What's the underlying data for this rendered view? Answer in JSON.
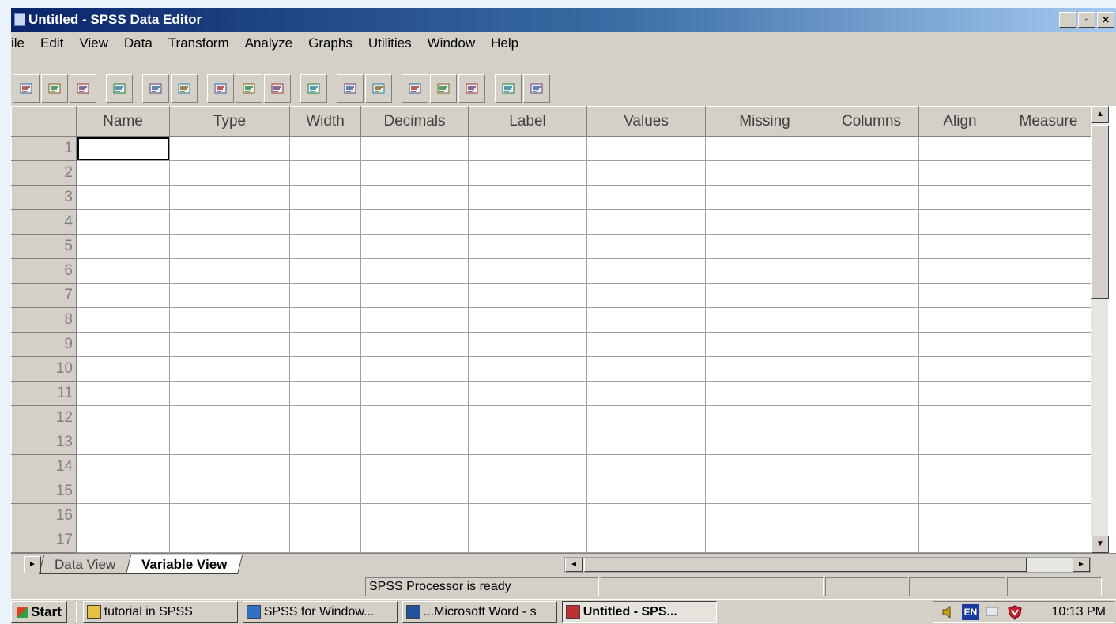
{
  "window": {
    "title": "Untitled - SPSS Data Editor",
    "controls": [
      "_",
      "▫",
      "✕"
    ]
  },
  "menu": [
    "ile",
    "Edit",
    "View",
    "Data",
    "Transform",
    "Analyze",
    "Graphs",
    "Utilities",
    "Window",
    "Help"
  ],
  "toolbar": {
    "groups": [
      [
        "open-icon",
        "save-icon",
        "print-icon"
      ],
      [
        "dialog-recall-icon"
      ],
      [
        "undo-icon",
        "redo-icon"
      ],
      [
        "goto-chart-icon",
        "goto-case-icon",
        "variables-icon"
      ],
      [
        "find-icon"
      ],
      [
        "insert-case-icon",
        "insert-variable-icon"
      ],
      [
        "split-file-icon",
        "weight-cases-icon",
        "select-cases-icon"
      ],
      [
        "value-labels-icon",
        "use-sets-icon"
      ]
    ]
  },
  "grid": {
    "columns": [
      "Name",
      "Type",
      "Width",
      "Decimals",
      "Label",
      "Values",
      "Missing",
      "Columns",
      "Align",
      "Measure"
    ],
    "rows": [
      "1",
      "2",
      "3",
      "4",
      "5",
      "6",
      "7",
      "8",
      "9",
      "10",
      "11",
      "12",
      "13",
      "14",
      "15",
      "16",
      "17"
    ]
  },
  "tabs": {
    "data_view": "Data View",
    "variable_view": "Variable View"
  },
  "status": {
    "message": "SPSS Processor  is ready"
  },
  "taskbar": {
    "start": "Start",
    "buttons": [
      {
        "label": "tutorial in SPSS",
        "icon": "folder-icon",
        "active": false
      },
      {
        "label": "SPSS for Window...",
        "icon": "browser-icon",
        "active": false
      },
      {
        "label": "...Microsoft Word - s",
        "icon": "word-icon",
        "active": false
      },
      {
        "label": "Untitled - SPS...",
        "icon": "spss-icon",
        "active": true
      }
    ],
    "clock": "10:13 PM",
    "language": "EN"
  },
  "colors": {
    "title_start": "#0a246a",
    "title_end": "#a6caf0",
    "chrome": "#d4d0c8"
  }
}
